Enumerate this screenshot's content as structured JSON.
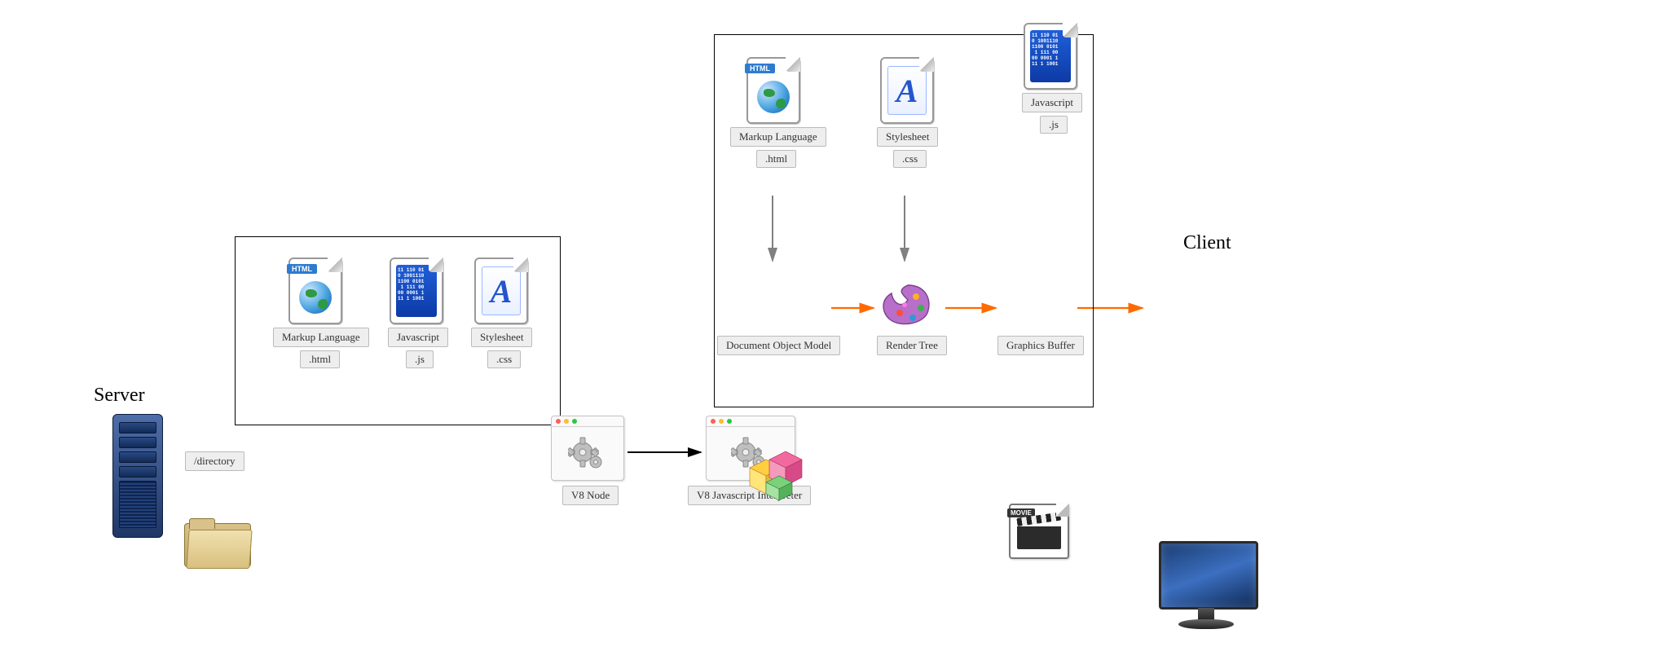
{
  "headings": {
    "server": "Server",
    "client": "Client"
  },
  "server": {
    "directory_label": "/directory",
    "files": {
      "html": {
        "title": "Markup Language",
        "ext": ".html",
        "banner": "HTML"
      },
      "js": {
        "title": "Javascript",
        "ext": ".js"
      },
      "css": {
        "title": "Stylesheet",
        "ext": ".css"
      }
    }
  },
  "engines": {
    "v8_node": "V8 Node",
    "v8_interpreter": "V8 Javascript Interpreter"
  },
  "client": {
    "files": {
      "html": {
        "title": "Markup Language",
        "ext": ".html",
        "banner": "HTML"
      },
      "css": {
        "title": "Stylesheet",
        "ext": ".css"
      },
      "js": {
        "title": "Javascript",
        "ext": ".js"
      }
    },
    "nodes": {
      "dom": "Document Object Model",
      "render": "Render Tree",
      "buffer": "Graphics Buffer",
      "movie_tag": "MOVIE"
    }
  },
  "binary_sample": "11 110 01\n0 1001110\n1100 0101\n 1 111 00\n00 0001 1\n11 1 1001",
  "colors": {
    "arrow_black": "#000000",
    "arrow_gray": "#808080",
    "arrow_orange": "#ff6a00",
    "traffic_red": "#ff5f57",
    "traffic_yellow": "#febc2e",
    "traffic_green": "#28c840"
  }
}
